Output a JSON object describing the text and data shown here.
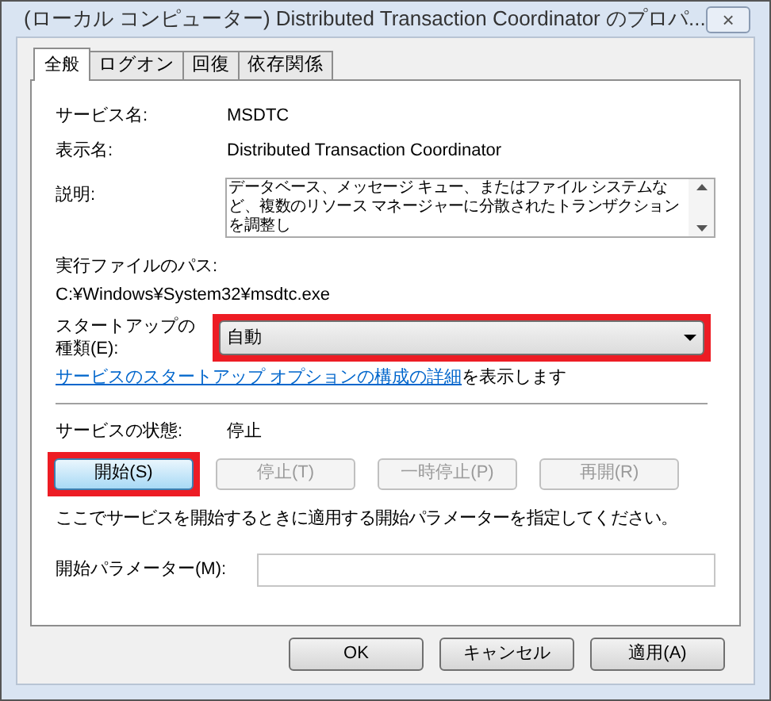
{
  "window": {
    "title": "(ローカル コンピューター) Distributed Transaction Coordinator のプロパ...",
    "close": "×"
  },
  "tabs": [
    {
      "label": "全般",
      "selected": true
    },
    {
      "label": "ログオン",
      "selected": false
    },
    {
      "label": "回復",
      "selected": false
    },
    {
      "label": "依存関係",
      "selected": false
    }
  ],
  "general": {
    "service_name": {
      "label": "サービス名:",
      "value": "MSDTC"
    },
    "display_name": {
      "label": "表示名:",
      "value": "Distributed Transaction Coordinator"
    },
    "description": {
      "label": "説明:",
      "value": "データベース、メッセージ キュー、またはファイル システムなど、複数のリソース マネージャーに分散されたトランザクションを調整し"
    },
    "path": {
      "label": "実行ファイルのパス:",
      "value": "C:¥Windows¥System32¥msdtc.exe"
    },
    "startup_type": {
      "label": "スタートアップの種類(E):",
      "value": "自動",
      "highlighted": true
    },
    "help": {
      "link": "サービスのスタートアップ オプションの構成の詳細",
      "text": "を表示します"
    },
    "status": {
      "label": "サービスの状態:",
      "value": "停止"
    },
    "service_buttons": [
      {
        "label": "開始(S)",
        "disabled": false,
        "highlighted": true
      },
      {
        "label": "停止(T)",
        "disabled": true,
        "highlighted": false
      },
      {
        "label": "一時停止(P)",
        "disabled": true,
        "highlighted": false
      },
      {
        "label": "再開(R)",
        "disabled": true,
        "highlighted": false
      }
    ],
    "hint": "ここでサービスを開始するときに適用する開始パラメーターを指定してください。",
    "parameters": {
      "label": "開始パラメーター(M):"
    }
  },
  "buttons": [
    {
      "label": "OK"
    },
    {
      "label": "キャンセル"
    },
    {
      "label": "適用(A)"
    }
  ]
}
